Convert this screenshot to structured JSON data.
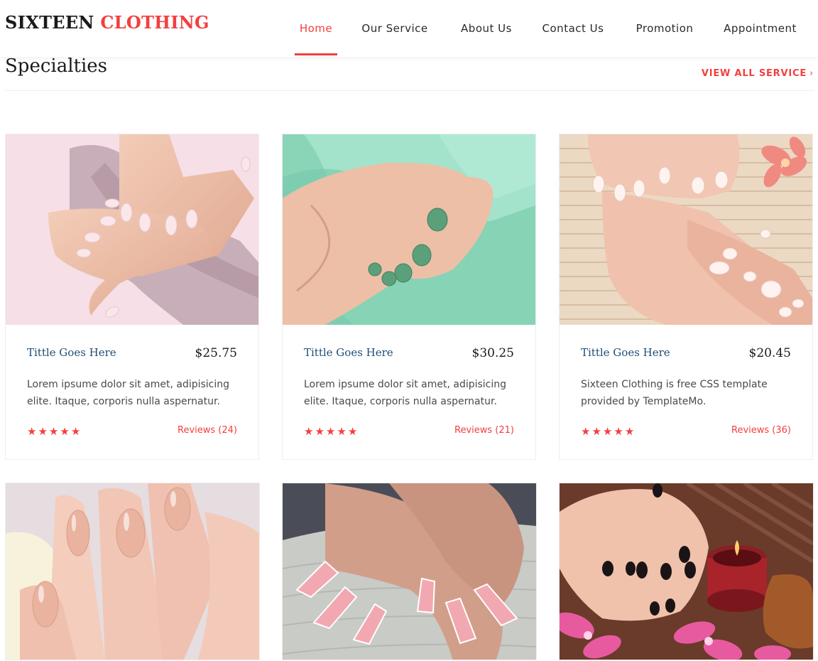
{
  "header": {
    "logo_main": "SIXTEEN",
    "logo_accent": "CLOTHING",
    "nav": [
      {
        "label": "Home"
      },
      {
        "label": "Our Service"
      },
      {
        "label": "About Us"
      },
      {
        "label": "Contact Us"
      },
      {
        "label": "Promotion"
      },
      {
        "label": "Appointment"
      }
    ],
    "active_nav": "Home"
  },
  "section": {
    "title": "Specialties",
    "view_all": "VIEW ALL SERVICE",
    "view_all_icon": "chevron-right-icon"
  },
  "products": [
    {
      "title": "Tittle Goes Here",
      "price": "$25.75",
      "description": "Lorem ipsume dolor sit amet, adipisicing elite. Itaque, corporis nulla aspernatur.",
      "rating": 5,
      "reviews": "Reviews (24)",
      "image": "hands with pink manicure on pink towel"
    },
    {
      "title": "Tittle Goes Here",
      "price": "$30.25",
      "description": "Lorem ipsume dolor sit amet, adipisicing elite. Itaque, corporis nulla aspernatur.",
      "rating": 5,
      "reviews": "Reviews (21)",
      "image": "hand with green nails on mint fabric"
    },
    {
      "title": "Tittle Goes Here",
      "price": "$20.45",
      "description": "Sixteen Clothing is free CSS template provided by TemplateMo.",
      "rating": 5,
      "reviews": "Reviews (36)",
      "image": "french manicure hands and feet with flower"
    },
    {
      "image": "nude glossy nails with white flower"
    },
    {
      "image": "pink almond nails on lace cushion"
    },
    {
      "image": "black nails with candle and orchids"
    }
  ],
  "colors": {
    "accent": "#f33f3f",
    "title_blue": "#1e4d78"
  }
}
